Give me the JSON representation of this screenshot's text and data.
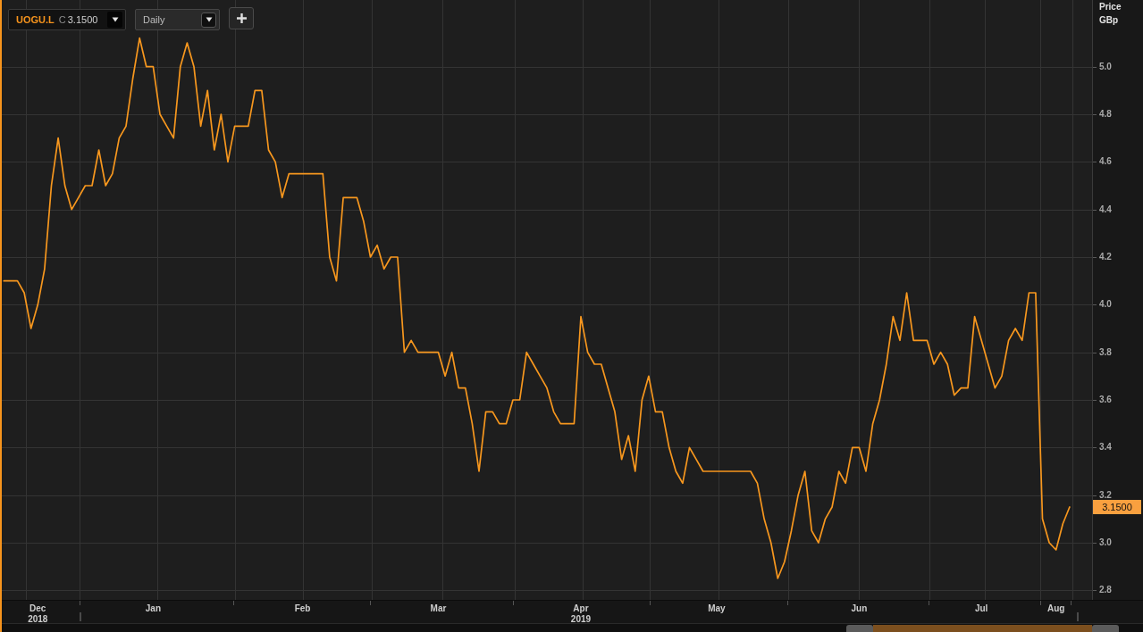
{
  "toolbar": {
    "symbol_dropdown": {
      "ticker": "UOGU.L",
      "field": "C",
      "value": "3.1500"
    },
    "interval_dropdown": {
      "value": "Daily"
    }
  },
  "price_axis": {
    "title": "Price",
    "unit": "GBp",
    "last_price_tag": "3.1500"
  },
  "chart_data": {
    "type": "line",
    "grid": true,
    "categories": [
      null,
      null,
      null,
      null,
      null,
      "Dec 2018",
      null,
      null,
      null,
      null,
      null,
      null,
      null,
      null,
      null,
      null,
      null,
      null,
      null,
      null,
      null,
      null,
      "Jan",
      null,
      null,
      null,
      null,
      null,
      null,
      null,
      null,
      null,
      null,
      null,
      null,
      null,
      null,
      null,
      null,
      null,
      null,
      null,
      null,
      null,
      "Feb",
      null,
      null,
      null,
      null,
      null,
      null,
      null,
      null,
      null,
      null,
      null,
      null,
      null,
      null,
      null,
      null,
      null,
      null,
      null,
      "Mar",
      null,
      null,
      null,
      null,
      null,
      null,
      null,
      null,
      null,
      null,
      null,
      null,
      null,
      null,
      null,
      null,
      null,
      null,
      null,
      null,
      "Apr 2019",
      null,
      null,
      null,
      null,
      null,
      null,
      null,
      null,
      null,
      null,
      null,
      null,
      null,
      null,
      null,
      null,
      null,
      null,
      null,
      "May",
      null,
      null,
      null,
      null,
      null,
      null,
      null,
      null,
      null,
      null,
      null,
      null,
      null,
      null,
      null,
      null,
      null,
      null,
      null,
      null,
      "Jun",
      null,
      null,
      null,
      null,
      null,
      null,
      null,
      null,
      null,
      null,
      null,
      null,
      null,
      null,
      null,
      null,
      null,
      "Jul",
      null,
      null,
      null,
      null,
      null,
      null,
      null,
      null,
      null,
      null,
      "Aug",
      null,
      null
    ],
    "series": [
      {
        "color": "#f7971e",
        "values": [
          4.1,
          4.1,
          4.1,
          4.05,
          3.9,
          4.0,
          4.15,
          4.5,
          4.7,
          4.5,
          4.4,
          4.45,
          4.5,
          4.5,
          4.65,
          4.5,
          4.55,
          4.7,
          4.75,
          4.95,
          5.12,
          5.0,
          5.0,
          4.8,
          4.75,
          4.7,
          5.0,
          5.1,
          5.0,
          4.75,
          4.9,
          4.65,
          4.8,
          4.6,
          4.75,
          4.75,
          4.75,
          4.9,
          4.9,
          4.65,
          4.6,
          4.45,
          4.55,
          4.55,
          4.55,
          4.55,
          4.55,
          4.55,
          4.2,
          4.1,
          4.45,
          4.45,
          4.45,
          4.35,
          4.2,
          4.25,
          4.15,
          4.2,
          4.2,
          3.8,
          3.85,
          3.8,
          3.8,
          3.8,
          3.8,
          3.7,
          3.8,
          3.65,
          3.65,
          3.5,
          3.3,
          3.55,
          3.55,
          3.5,
          3.5,
          3.6,
          3.6,
          3.8,
          3.75,
          3.7,
          3.65,
          3.55,
          3.5,
          3.5,
          3.5,
          3.95,
          3.8,
          3.75,
          3.75,
          3.65,
          3.55,
          3.35,
          3.45,
          3.3,
          3.6,
          3.7,
          3.55,
          3.55,
          3.4,
          3.3,
          3.25,
          3.4,
          3.35,
          3.3,
          3.3,
          3.3,
          3.3,
          3.3,
          3.3,
          3.3,
          3.3,
          3.25,
          3.1,
          3.0,
          2.85,
          2.92,
          3.05,
          3.2,
          3.3,
          3.05,
          3.0,
          3.1,
          3.15,
          3.3,
          3.25,
          3.4,
          3.4,
          3.3,
          3.5,
          3.6,
          3.75,
          3.95,
          3.85,
          4.05,
          3.85,
          3.85,
          3.85,
          3.75,
          3.8,
          3.75,
          3.62,
          3.65,
          3.65,
          3.95,
          3.85,
          3.75,
          3.65,
          3.7,
          3.85,
          3.9,
          3.85,
          4.05,
          4.05,
          3.1,
          3.0,
          2.97,
          3.08,
          3.15
        ]
      }
    ],
    "ylim": [
      2.76,
      5.28
    ],
    "yticks": [
      {
        "value": 2.8,
        "label": "2.8"
      },
      {
        "value": 3.0,
        "label": "3.0"
      },
      {
        "value": 3.2,
        "label": "3.2"
      },
      {
        "value": 3.4,
        "label": "3.4"
      },
      {
        "value": 3.6,
        "label": "3.6"
      },
      {
        "value": 3.8,
        "label": "3.8"
      },
      {
        "value": 4.0,
        "label": "4.0"
      },
      {
        "value": 4.2,
        "label": "4.2"
      },
      {
        "value": 4.4,
        "label": "4.4"
      },
      {
        "value": 4.6,
        "label": "4.6"
      },
      {
        "value": 4.8,
        "label": "4.8"
      },
      {
        "value": 5.0,
        "label": "5.0"
      }
    ]
  }
}
